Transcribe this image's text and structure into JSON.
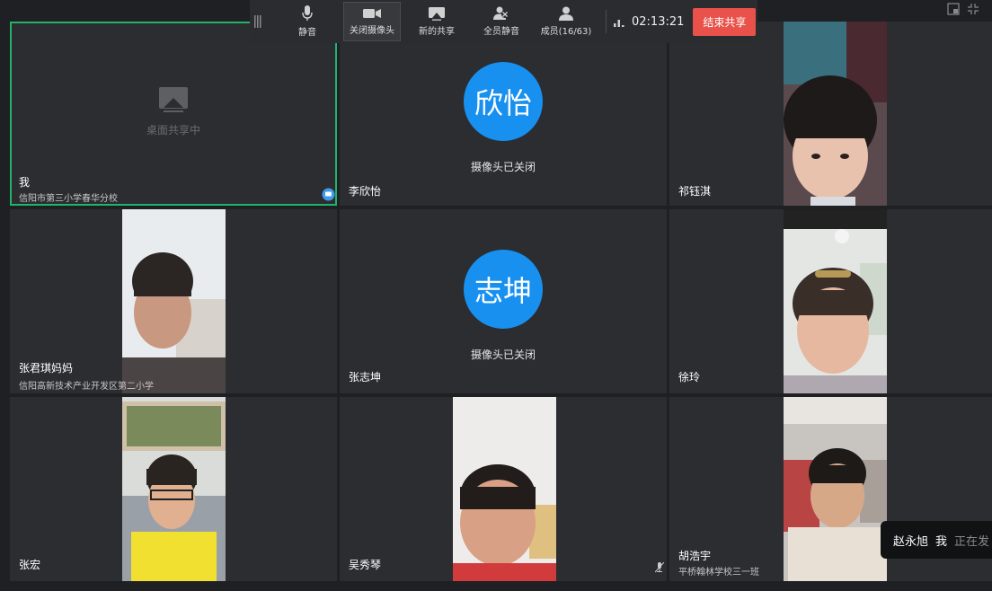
{
  "toolbar": {
    "mute": "静音",
    "camera_off": "关闭摄像头",
    "new_share": "新的共享",
    "mute_all": "全员静音",
    "members": "成员(16/63)",
    "timer": "02:13:21",
    "end_share": "结束共享"
  },
  "tiles": {
    "me": {
      "name": "我",
      "org": "信阳市第三小学春华分校",
      "share_label": "桌面共享中"
    },
    "t2": {
      "name": "李欣怡",
      "avatar": "欣怡",
      "status": "摄像头已关闭"
    },
    "t3": {
      "name": "祁钰淇"
    },
    "t4": {
      "name": "张君琪妈妈",
      "org": "信阳高新技术产业开发区第二小学"
    },
    "t5": {
      "name": "张志坤",
      "avatar": "志坤",
      "status": "摄像头已关闭"
    },
    "t6": {
      "name": "徐玲"
    },
    "t7": {
      "name": "张宏"
    },
    "t8": {
      "name": "吴秀琴"
    },
    "t9": {
      "name": "胡浩宇",
      "org": "平桥翰林学校三一班"
    }
  },
  "toast": {
    "speaker": "赵永旭",
    "me": "我",
    "status": "正在发"
  }
}
